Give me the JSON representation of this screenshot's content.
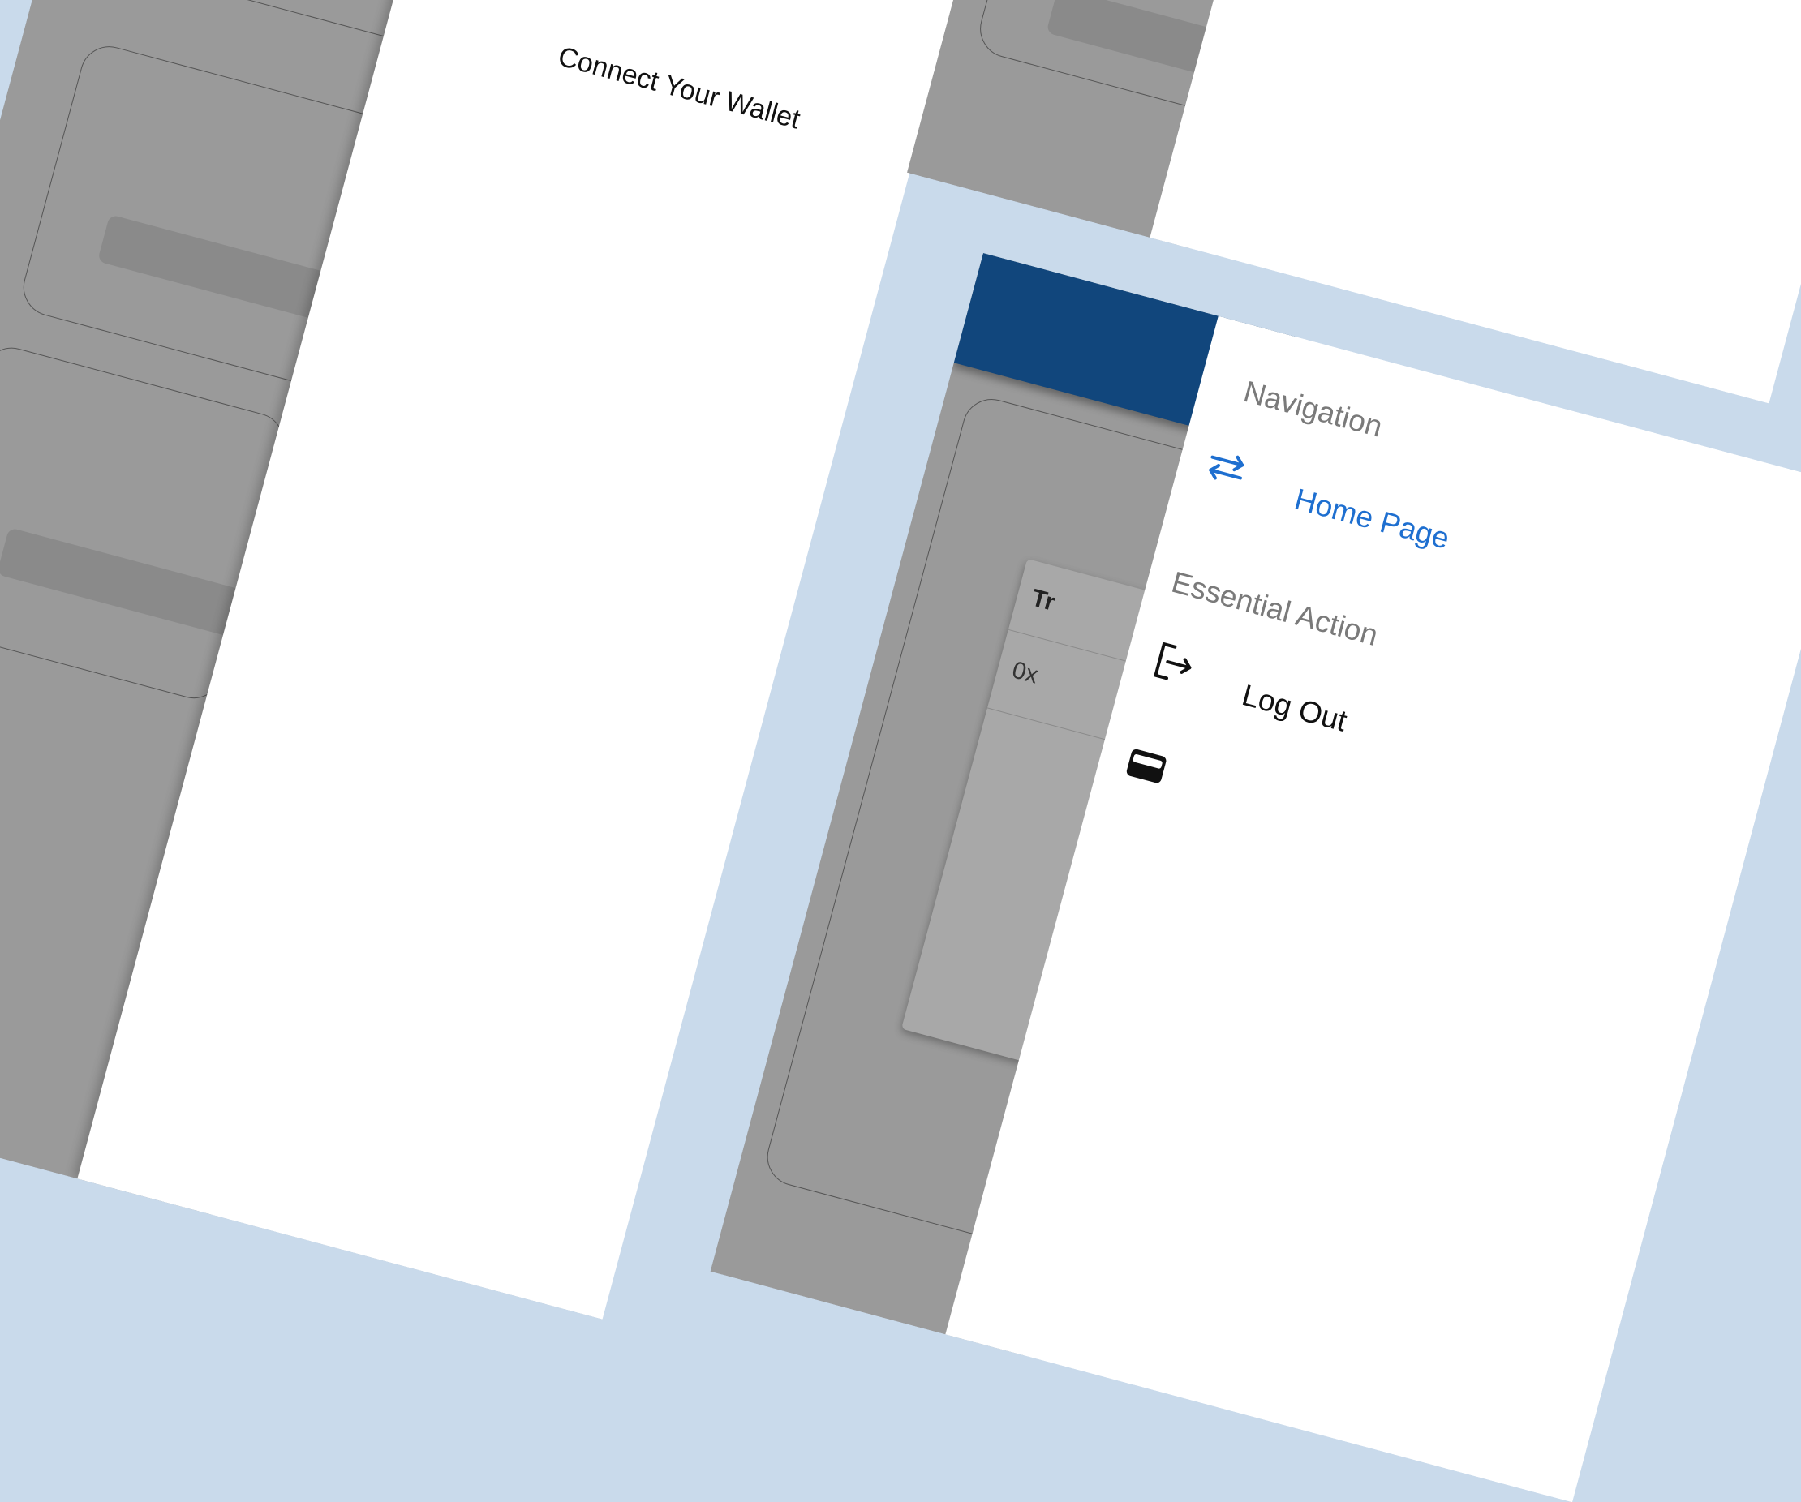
{
  "wallet_screen": {
    "connect_label": "Connect Your Wallet",
    "address_prefix": "0x"
  },
  "drawer": {
    "sections": [
      {
        "header": "Navigation",
        "items": [
          {
            "label": "Home Page",
            "icon": "swap-arrows-icon"
          }
        ]
      },
      {
        "header": "Essential Action",
        "items": [
          {
            "label": "Log Out",
            "icon": "logout-icon"
          }
        ]
      }
    ],
    "partial_item_icon": "wallet-icon"
  },
  "table": {
    "header_fragment": "Tr",
    "row_fragment": "0x"
  },
  "colors": {
    "background": "#c9daeb",
    "appbar": "#11467c",
    "accent": "#1e6fd0",
    "scrim": "#9a9a9a"
  }
}
